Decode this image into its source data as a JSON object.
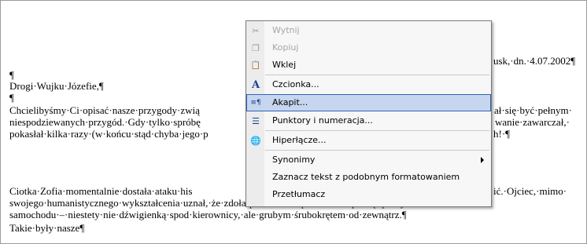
{
  "document": {
    "paragraph_mark_1": "¶",
    "header_right": "usk,·dn.·4.07.2002¶",
    "greeting": "Drogi·Wujku·Józefie,¶",
    "paragraph_mark_2": "¶",
    "p1_l1_left": "Chcielibyśmy·Ci·opisać·nasze·przygody·zwią",
    "p1_l1_right": "ał·się·być·pełnym·",
    "p1_l2_left": "niespodziewanych·przygód.·Gdy·tylko·spróbę",
    "p1_l2_right": "wanie·zawarczał,·",
    "p1_l3_left": "pokasłał·kilka·razy·(w·końcu·stąd·chyba·jego·p",
    "p1_l3_right": "h!·¶",
    "p2_l1_left": "Ciotka·Zofia·momentalnie·dostała·ataku·his",
    "p2_l1_right": "ić.·Ojciec,·mimo·",
    "p2_l2": "swojego·humanistycznego·wykształcenia·uznał,·że·zdoła·pomóc·w·naprawie·i·rozpoczął·próby·otwarcia·maski·",
    "p2_l3": "samochodu·–·niestety·nie·dźwigienką·spod·kierownicy,·ale·grubym·śrubokrętem·od·zewnątrz.¶",
    "p3_l1": "Takie·były·nasze¶"
  },
  "context_menu": {
    "items": [
      {
        "label": "Wytnij",
        "icon": "scissors-icon",
        "glyph": "✂",
        "disabled": true
      },
      {
        "label": "Kopiuj",
        "icon": "copy-icon",
        "glyph": "❐",
        "disabled": true
      },
      {
        "label": "Wklej",
        "icon": "paste-icon",
        "glyph": "📋",
        "disabled": false
      },
      {
        "label": "Czcionka...",
        "icon": "font-icon",
        "glyph": "A",
        "disabled": false
      },
      {
        "label": "Akapit...",
        "icon": "paragraph-icon",
        "glyph": "≡¶",
        "disabled": false,
        "highlighted": true
      },
      {
        "label": "Punktory i numeracja...",
        "icon": "bullets-icon",
        "glyph": "☰",
        "disabled": false
      },
      {
        "label": "Hiperłącze...",
        "icon": "hyperlink-icon",
        "glyph": "🌐",
        "disabled": false
      },
      {
        "label": "Synonimy",
        "icon": "submenu-arrow-icon",
        "disabled": false,
        "submenu": true
      },
      {
        "label": "Zaznacz tekst z podobnym formatowaniem",
        "disabled": false
      },
      {
        "label": "Przetłumacz",
        "disabled": false
      }
    ]
  },
  "colors": {
    "highlight_bg": "#c6d6ef",
    "highlight_border": "#3162b5",
    "disabled_text": "#a6a6a6",
    "menu_bg": "#f7f7f7",
    "gutter_bg": "#ececec"
  }
}
